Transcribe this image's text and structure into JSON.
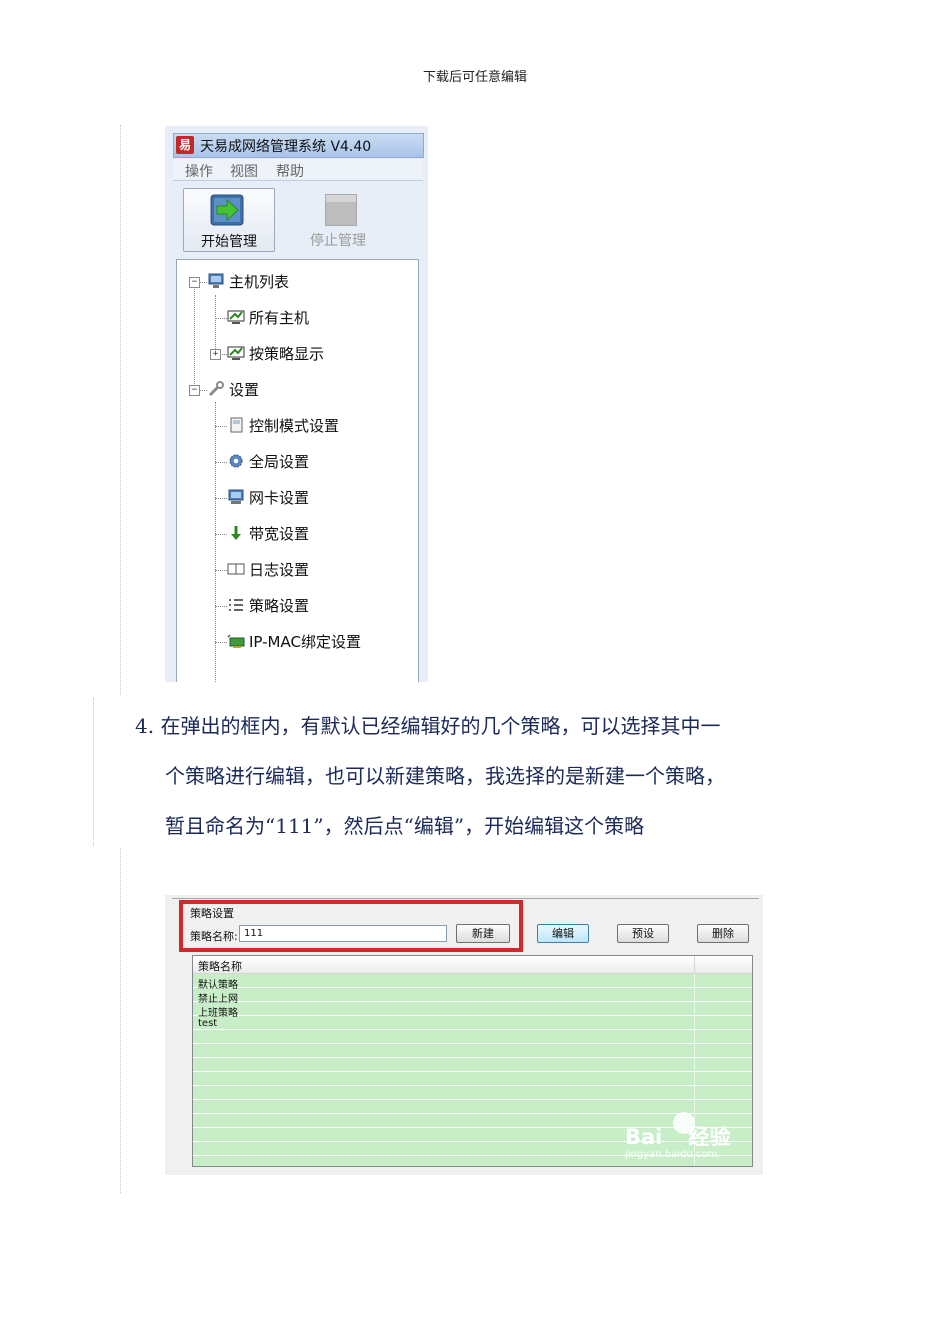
{
  "header": {
    "text": "下载后可任意编辑"
  },
  "app": {
    "title": "天易成网络管理系统 V4.40",
    "logo_glyph": "易",
    "menu": [
      "操作",
      "视图",
      "帮助"
    ],
    "toolbar": {
      "start_label": "开始管理",
      "stop_label": "停止管理"
    },
    "tree": {
      "host_list": "主机列表",
      "all_hosts": "所有主机",
      "by_policy": "按策略显示",
      "settings": "设置",
      "control_mode": "控制模式设置",
      "global": "全局设置",
      "nic": "网卡设置",
      "bandwidth": "带宽设置",
      "log": "日志设置",
      "policy": "策略设置",
      "ipmac": "IP-MAC绑定设置"
    }
  },
  "step": {
    "line1": "4. 在弹出的框内，有默认已经编辑好的几个策略，可以选择其中一",
    "line2": "个策略进行编辑，也可以新建策略，我选择的是新建一个策略，",
    "line3": "暂且命名为“111”，然后点“编辑”，开始编辑这个策略"
  },
  "policy_dialog": {
    "group_title": "策略设置",
    "name_label": "策略名称:",
    "name_value": "111",
    "btn_new": "新建",
    "btn_edit": "编辑",
    "btn_preset": "预设",
    "btn_delete": "删除",
    "column": "策略名称",
    "rows": [
      "默认策略",
      "禁止上网",
      "上班策略",
      "test"
    ],
    "watermark": "Bai",
    "watermark_suffix": "经验",
    "watermark_url": "jingyan.baidu.com"
  },
  "colors": {
    "highlight_red": "#d22a2a",
    "list_green": "#c7eec7",
    "text_blue": "#1b2a5a"
  }
}
